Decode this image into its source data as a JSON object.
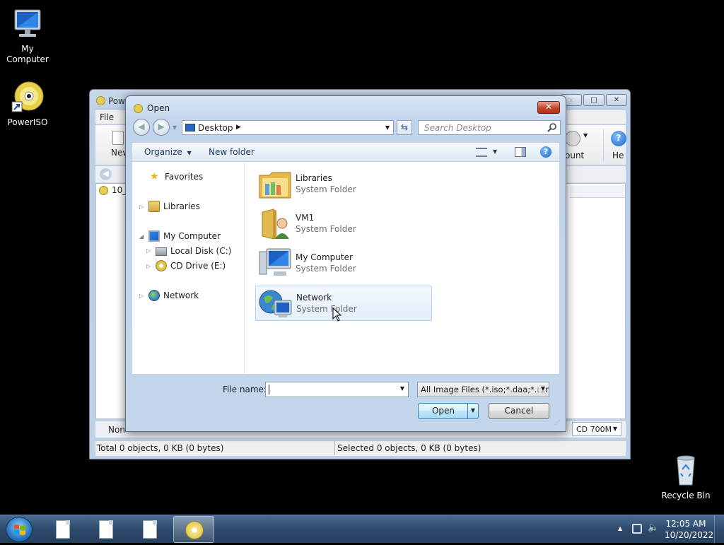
{
  "desktop": {
    "icons": [
      {
        "label": "My Computer"
      },
      {
        "label": "PowerISO"
      },
      {
        "label": "Recycle Bin"
      }
    ]
  },
  "poweriso": {
    "title": "Pow",
    "menu_file": "File",
    "toolbar_new": "New",
    "toolbar_mount": "ount",
    "toolbar_help": "He",
    "tree_item": "10_",
    "bottom_label": "Non-",
    "media_select": "CD 700M",
    "status_total": "Total 0 objects, 0 KB (0 bytes)",
    "status_selected": "Selected 0 objects, 0 KB (0 bytes)"
  },
  "dialog": {
    "title": "Open",
    "close": "✕",
    "address": "Desktop",
    "search_placeholder": "Search Desktop",
    "commands": {
      "organize": "Organize",
      "new_folder": "New folder"
    },
    "nav": {
      "favorites": "Favorites",
      "libraries": "Libraries",
      "my_computer": "My Computer",
      "local_disk": "Local Disk (C:)",
      "cd_drive": "CD Drive (E:)",
      "network": "Network"
    },
    "items": [
      {
        "name": "Libraries",
        "type": "System Folder"
      },
      {
        "name": "VM1",
        "type": "System Folder"
      },
      {
        "name": "My Computer",
        "type": "System Folder"
      },
      {
        "name": "Network",
        "type": "System Folder"
      }
    ],
    "file_name_label": "File name:",
    "file_name_value": "",
    "file_type": "All Image Files (*.iso;*.daa;*.rar;",
    "open_button": "Open",
    "cancel_button": "Cancel"
  },
  "taskbar": {
    "time": "12:05 AM",
    "date": "10/20/2022"
  }
}
